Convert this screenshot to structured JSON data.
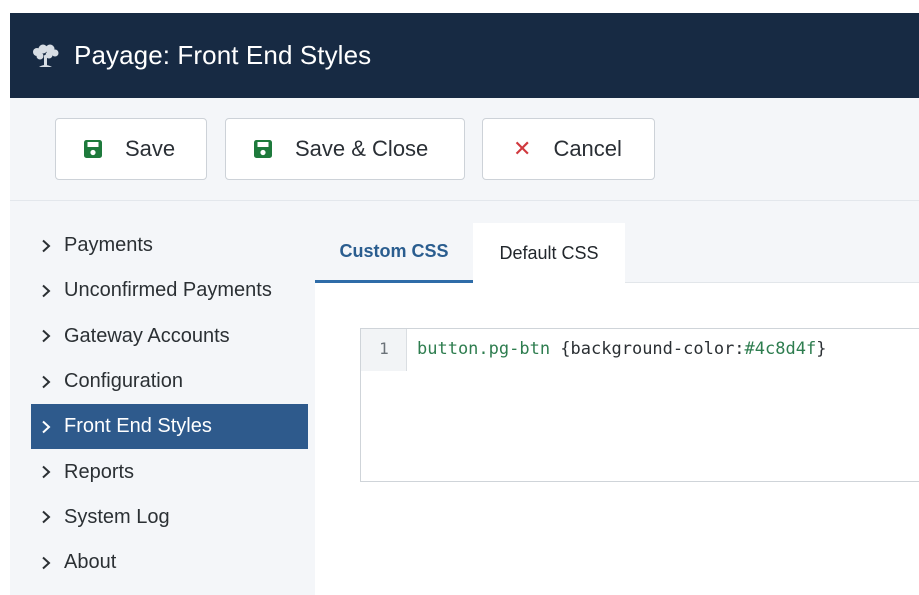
{
  "header": {
    "title": "Payage: Front End Styles",
    "logo_icon": "tree-icon"
  },
  "toolbar": {
    "save_label": "Save",
    "save_close_label": "Save & Close",
    "cancel_label": "Cancel",
    "save_icon": "floppy-disk-icon",
    "cancel_icon": "x-icon",
    "save_icon_color": "#1e7a3c",
    "cancel_icon_color": "#d0393e"
  },
  "sidebar": {
    "items": [
      {
        "label": "Payments",
        "active": false
      },
      {
        "label": "Unconfirmed Payments",
        "active": false
      },
      {
        "label": "Gateway Accounts",
        "active": false
      },
      {
        "label": "Configuration",
        "active": false
      },
      {
        "label": "Front End Styles",
        "active": true
      },
      {
        "label": "Reports",
        "active": false
      },
      {
        "label": "System Log",
        "active": false
      },
      {
        "label": "About",
        "active": false
      }
    ],
    "active_color": "#2e5a8c"
  },
  "tabs": [
    {
      "label": "Custom CSS",
      "active": true
    },
    {
      "label": "Default CSS",
      "active": false
    }
  ],
  "editor": {
    "lines": [
      {
        "number": "1",
        "selector": "button.pg-btn",
        "open_brace": " {",
        "property": "background-color:",
        "value": "#4c8d4f",
        "close_brace": "}"
      }
    ]
  },
  "colors": {
    "header_bg": "#172a43",
    "tab_active_text": "#2a5d8f"
  }
}
